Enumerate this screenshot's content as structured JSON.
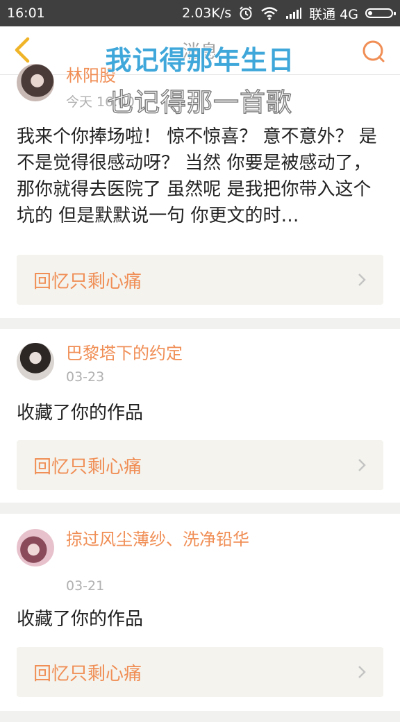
{
  "status_bar": {
    "time": "16:01",
    "speed": "2.03K/s",
    "carrier": "联通 4G"
  },
  "header": {
    "title": "消息",
    "back_icon": "chevron-left-icon",
    "search_icon": "search-icon",
    "accent_color": "#f08e55"
  },
  "overlay": {
    "line1": "我记得那年生日",
    "line2": "也记得那一首歌"
  },
  "cards": [
    {
      "user": "林阳股",
      "date": "今天 16:00",
      "message": "我来个你捧场啦！ 惊不惊喜？ 意不意外？ 是不是觉得很感动呀？ 当然 你要是被感动了，那你就得去医院了 虽然呢 是我把你带入这个坑的 但是默默说一句 你更文的时…",
      "work_title": "回忆只剩心痛"
    },
    {
      "user": "巴黎塔下的约定",
      "date": "03-23",
      "message": "收藏了你的作品",
      "work_title": "回忆只剩心痛"
    },
    {
      "user": "掠过风尘薄纱、洗净铅华",
      "date": "03-21",
      "message": "收藏了你的作品",
      "work_title": "回忆只剩心痛"
    }
  ]
}
